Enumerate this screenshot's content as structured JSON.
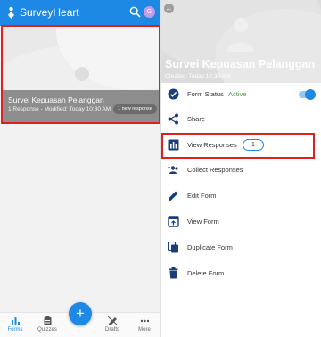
{
  "topbar": {
    "brand": "SurveyHeart",
    "avatar_letter": "G"
  },
  "card": {
    "title": "Survei Kepuasan Pelanggan",
    "meta": "1 Response - Modified: Today 10:30 AM",
    "badge": "1 new response"
  },
  "fab_label": "+",
  "bottomnav": {
    "items": [
      {
        "label": "Forms"
      },
      {
        "label": "Quizzes"
      },
      {
        "label": "Drafts"
      },
      {
        "label": "More"
      }
    ]
  },
  "detail": {
    "title": "Survei Kepuasan Pelanggan",
    "created": "Created: Today 10:30 AM",
    "form_status_label": "Form Status",
    "form_status_value": "Active",
    "share": "Share",
    "view_responses": "View Responses",
    "response_count": "1",
    "collect_responses": "Collect Responses",
    "edit_form": "Edit Form",
    "view_form": "View Form",
    "duplicate_form": "Duplicate Form",
    "delete_form": "Delete Form"
  },
  "colors": {
    "primary": "#1e88e5",
    "active_green": "#43a047",
    "highlight_red": "#e02020"
  }
}
